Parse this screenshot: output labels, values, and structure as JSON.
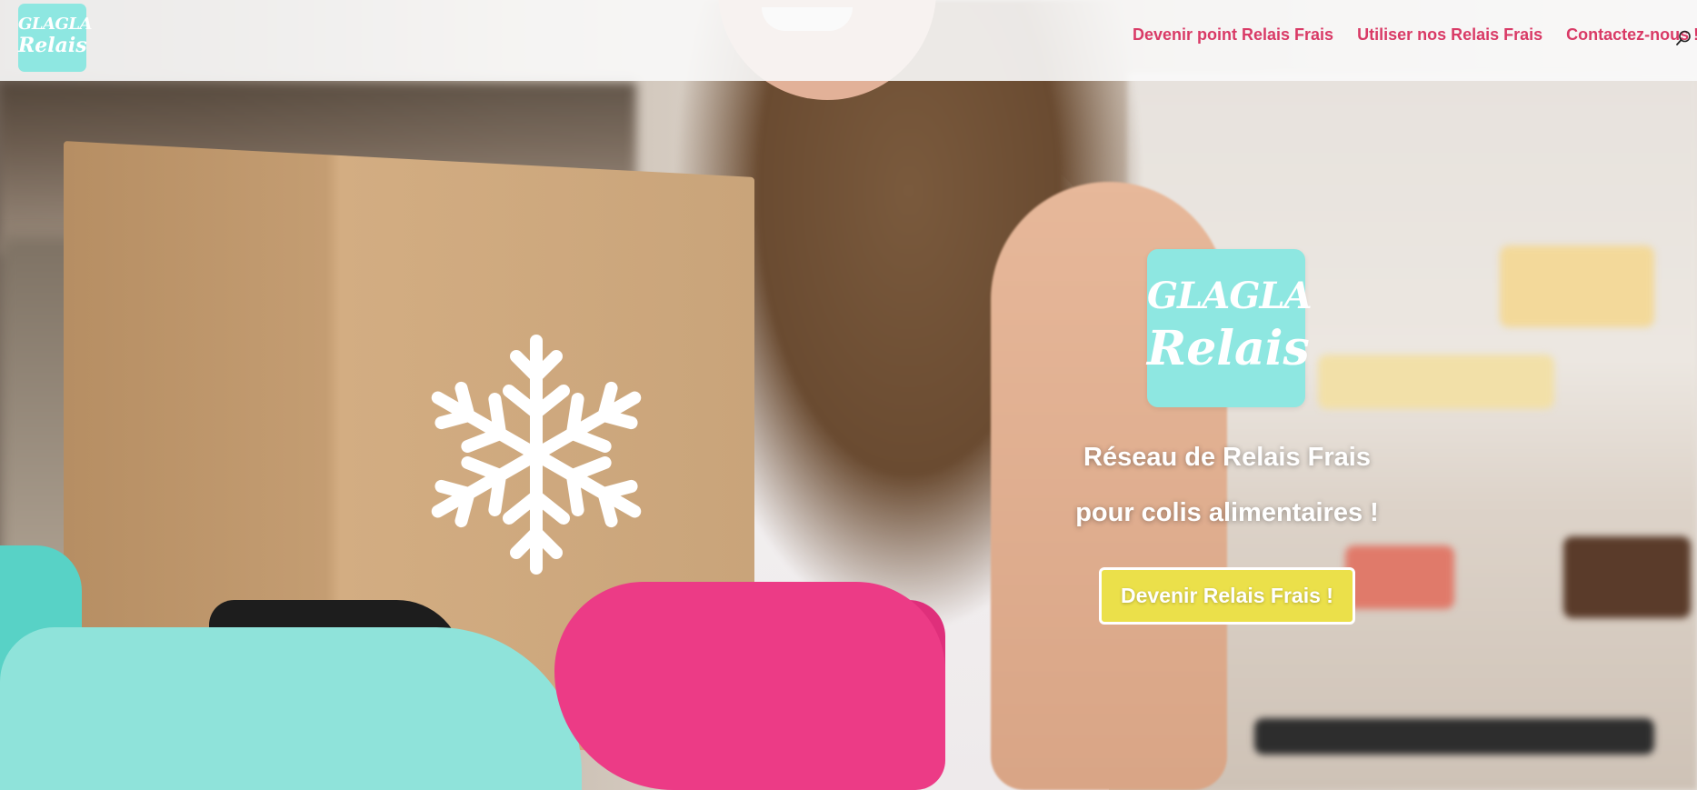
{
  "header": {
    "logo": {
      "line1": "GLAGLA",
      "line2": "Relais"
    },
    "nav": [
      {
        "label": "Devenir point Relais Frais"
      },
      {
        "label": "Utiliser nos Relais Frais"
      },
      {
        "label": "Contactez-nous !"
      }
    ],
    "search_icon": "search-icon"
  },
  "hero": {
    "logo": {
      "line1": "GLAGLA",
      "line2": "Relais"
    },
    "tagline_line1": "Réseau de Relais Frais",
    "tagline_line2": "pour colis alimentaires !",
    "cta_label": "Devenir Relais Frais !"
  },
  "colors": {
    "accent_nav": "#d93a66",
    "logo_bg": "#8ee7e1",
    "cta_bg": "#ebe04a"
  }
}
